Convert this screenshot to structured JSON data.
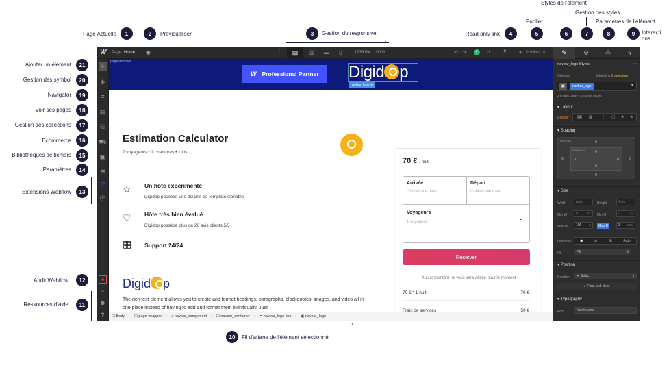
{
  "annotations": {
    "n1": {
      "num": "1",
      "label": "Page Actuelle"
    },
    "n2": {
      "num": "2",
      "label": "Prévisualiser"
    },
    "n3": {
      "num": "3",
      "label": "Gestion du responsive"
    },
    "n4": {
      "num": "4",
      "label": "Read only link"
    },
    "n5": {
      "num": "5",
      "label": "Publier"
    },
    "n6": {
      "num": "6",
      "label": "Styles de l'élément"
    },
    "n7": {
      "num": "7",
      "label": "Gestion des styles"
    },
    "n8": {
      "num": "8",
      "label": "Paramètres de l'élément"
    },
    "n9": {
      "num": "9",
      "label": "Interacti ons"
    },
    "n10": {
      "num": "10",
      "label": "Fil d'ariane de l'élément sélectionné"
    },
    "n11": {
      "num": "11",
      "label": "Ressources d'aide"
    },
    "n12": {
      "num": "12",
      "label": "Audit Webflow"
    },
    "n13": {
      "num": "13",
      "label": "Extensions Webflow"
    },
    "n14": {
      "num": "14",
      "label": "Paramètres"
    },
    "n15": {
      "num": "15",
      "label": "Bibliothèques de fichiers"
    },
    "n16": {
      "num": "16",
      "label": "Ecommerce"
    },
    "n17": {
      "num": "17",
      "label": "Gestion des collections"
    },
    "n18": {
      "num": "18",
      "label": "Voir ses pages"
    },
    "n19": {
      "num": "19",
      "label": "Navigator"
    },
    "n20": {
      "num": "20",
      "label": "Gestion des symbol"
    },
    "n21": {
      "num": "21",
      "label": "Ajouter un élément"
    }
  },
  "topbar": {
    "logo": "W",
    "page_prefix": "Page:",
    "page_name": "Home.",
    "viewport": "1236 PX",
    "zoom": "100 %",
    "publish": "Publish"
  },
  "canvas": {
    "wrapper_tag": "page-wrapper",
    "partner_logo": "W",
    "partner_label": "Professional Partner",
    "logo_text_a": "Digid",
    "logo_text_b": "p",
    "selected_tag": "navbar_logo",
    "title": "Estimation Calculator",
    "subtitle": "2 voyageurs • 1 chambres • 1 lits",
    "features": [
      {
        "title": "Un hôte expérimenté",
        "desc": "Digidop possède une dizaine de template clonable"
      },
      {
        "title": "Hôte très bien évalué",
        "desc": "Digidop possède plus de 20 avis clients 5/5"
      },
      {
        "title": "Support 24/24",
        "desc": ""
      }
    ],
    "brand_text_a": "Digid",
    "brand_text_b": "p",
    "rich_text": "The rich text element allows you to create and format headings, paragraphs, blockquotes, images, and video all in one place instead of having to add and format them individually. Just",
    "booking": {
      "price": "70 €",
      "per": "/ nuit",
      "arrivee": "Arrivée",
      "arrivee_ph": "Choisir une date",
      "depart": "Départ",
      "depart_ph": "Choisir une date",
      "voyageurs": "Voyageurs",
      "voyageurs_val": "1 voyageur",
      "reserve": "Réserver",
      "note": "Aucun montant ne vous sera débité pour le moment",
      "line1_label": "70 € * 1 nuit",
      "line1_val": "70 €",
      "line2_label": "Frais de services",
      "line2_val": "50 €"
    }
  },
  "breadcrumb": [
    "Body",
    "page-wrapper",
    "navbar_component",
    "navbar_container",
    "navbar_logo-link",
    "navbar_logo"
  ],
  "rpanel": {
    "header": "navbar_logo Styles",
    "selector_label": "Selector",
    "inheriting": "Inheriting",
    "inheriting_count": "2 selectors",
    "selector_tag": "navbar_logo",
    "on_page": "2 on this page, 2 on other pages",
    "layout": "Layout",
    "display": "Display",
    "spacing": "Spacing",
    "margin": "MARGIN",
    "padding": "PADDING",
    "zero": "0",
    "size": "Size",
    "width": "Width",
    "height": "Height",
    "auto": "Auto",
    "minw": "Min W",
    "minh": "Min H",
    "px": "PX",
    "maxw": "Max W",
    "maxw_val": "100",
    "pct": "%",
    "maxh": "Max H",
    "maxh_val": "3",
    "rem": "REM",
    "overflow": "Overflow",
    "fit": "Fit",
    "fit_val": "Fill",
    "position": "Position",
    "pos_val": "Static",
    "float": "Float and clear",
    "typography": "Typography",
    "font": "Font",
    "font_val": "Nunitosans"
  }
}
